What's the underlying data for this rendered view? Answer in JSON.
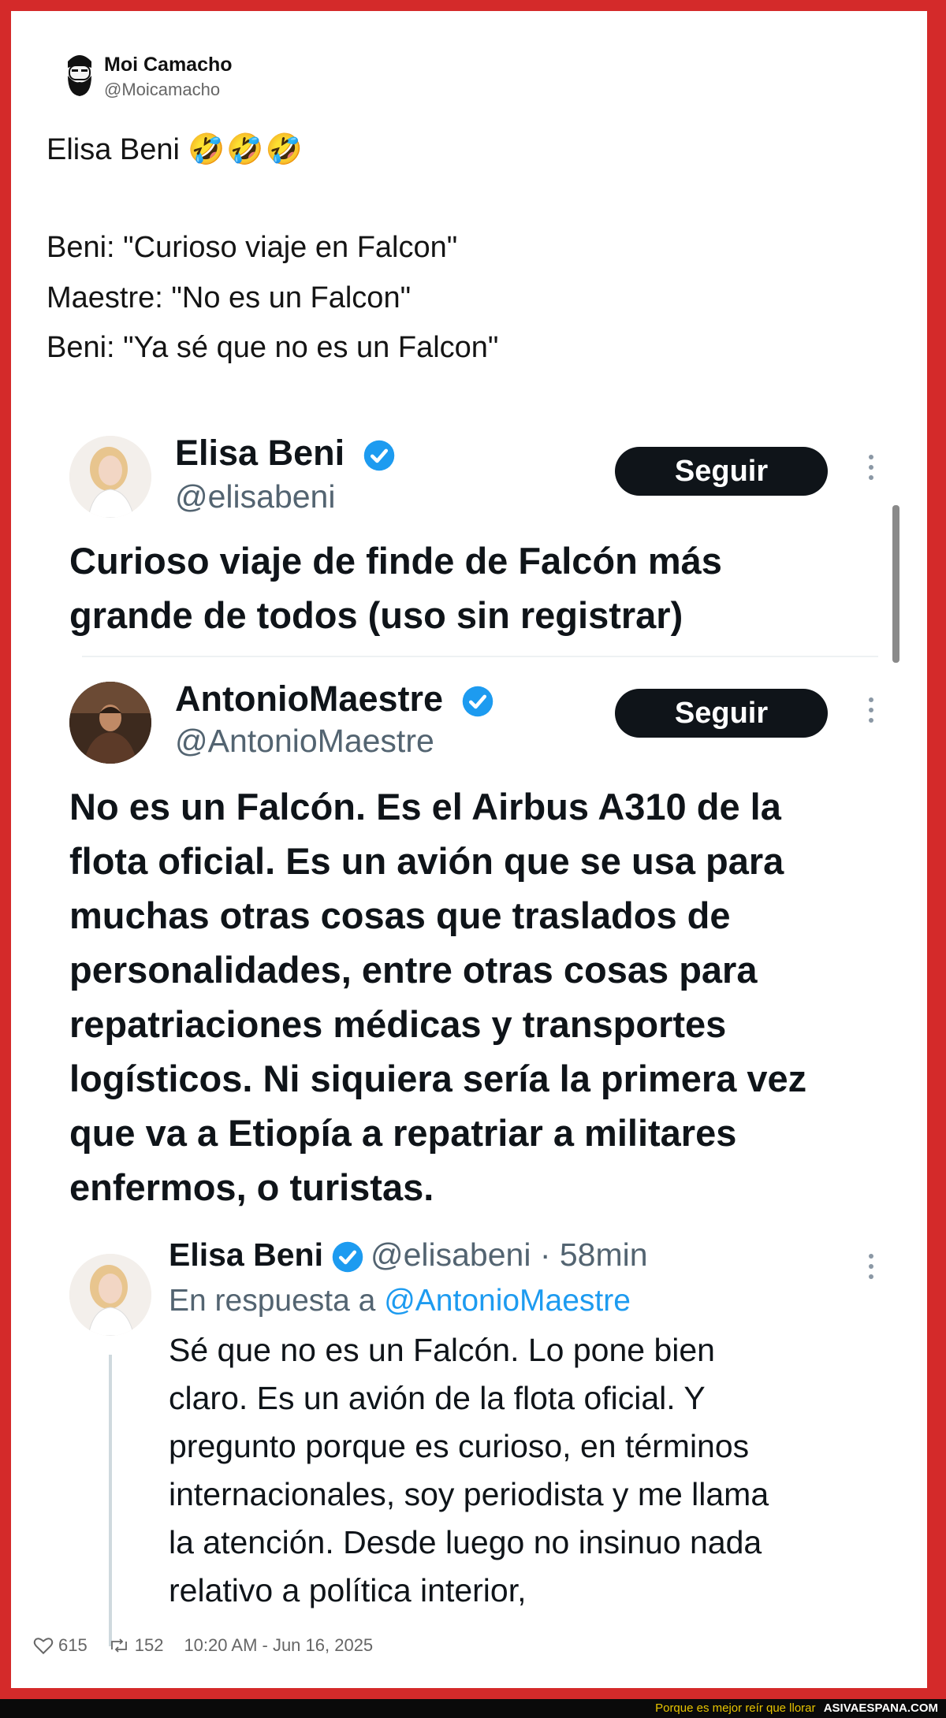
{
  "outer_tweet": {
    "author_name": "Moi Camacho",
    "author_handle": "@Moicamacho",
    "avatar_icon": "bearded-man-avatar-icon",
    "text_lines": [
      "Elisa Beni",
      "Beni: \"Curioso viaje en Falcon\"",
      "Maestre: \"No es un Falcon\"",
      "Beni: \"Ya sé que no es un Falcon\""
    ],
    "emojis": "🤣🤣🤣",
    "likes": "615",
    "retweets": "152",
    "timestamp": "10:20 AM - Jun 16, 2025"
  },
  "quoted": {
    "tweet1": {
      "name": "Elisa Beni",
      "handle": "@elisabeni",
      "follow_label": "Seguir",
      "lines": [
        "Curioso viaje de finde de Falcón más",
        "grande de todos (uso sin registrar)"
      ]
    },
    "tweet2": {
      "name": "AntonioMaestre",
      "handle": "@AntonioMaestre",
      "follow_label": "Seguir",
      "lines": [
        "No es un Falcón. Es el Airbus A310 de la",
        "flota oficial. Es un avión que se usa para",
        "muchas otras cosas que traslados de",
        "personalidades, entre otras cosas para",
        "repatriaciones médicas y transportes",
        "logísticos. Ni siquiera sería la primera vez",
        "que va a Etiopía a repatriar a militares",
        "enfermos, o turistas."
      ]
    },
    "reply": {
      "name": "Elisa Beni",
      "handle_time": "@elisabeni · 58min",
      "reply_prefix": "En respuesta a",
      "reply_to": "@AntonioMaestre",
      "lines": [
        "Sé que no es un Falcón. Lo pone bien",
        "claro. Es un avión de la flota oficial. Y",
        "pregunto porque es curioso, en términos",
        "internacionales, soy periodista y me llama",
        "la atención. Desde luego no insinuo nada",
        "relativo a política interior,"
      ]
    }
  },
  "watermark": {
    "tagline": "Porque es mejor reír que llorar",
    "site": "ASIVAESPANA.COM"
  },
  "colors": {
    "frame_red": "#d42a2a",
    "verified_blue": "#1d9bf0",
    "button_dark": "#0f1419"
  }
}
